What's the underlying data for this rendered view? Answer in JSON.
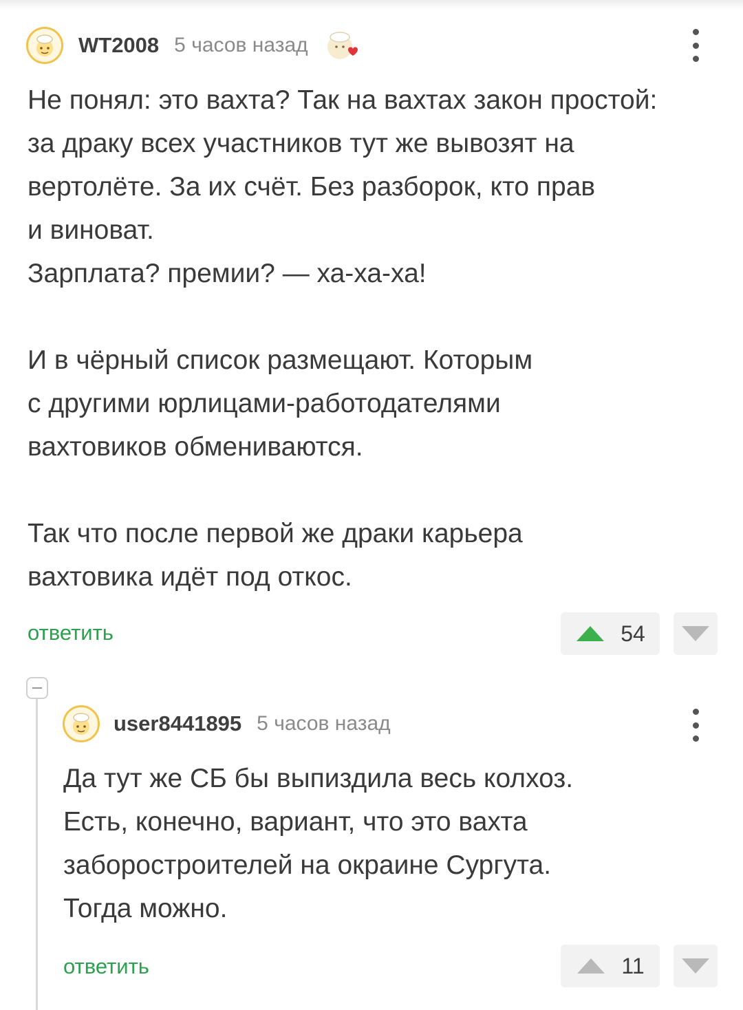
{
  "comments": [
    {
      "username": "WT2008",
      "time": "5 часов назад",
      "paragraphs": [
        [
          "Не понял: это вахта? Так на вахтах закон простой:",
          "за драку всех участников тут же вывозят на",
          "вертолёте. За их счёт. Без разборок, кто прав",
          "и виноват.",
          "Зарплата? премии? — ха-ха-ха!"
        ],
        [
          "И в чёрный список размещают. Которым",
          "с другими юрлицами-работодателями",
          "вахтовиков обмениваются."
        ],
        [
          "Так что после первой же драки карьера",
          "вахтовика идёт под откос."
        ]
      ],
      "reply_label": "ответить",
      "rating": "54",
      "upvoted": true
    },
    {
      "username": "user8441895",
      "time": "5 часов назад",
      "paragraphs": [
        [
          "Да тут же СБ бы выпиздила весь колхоз.",
          "Есть, конечно, вариант, что это вахта",
          "забороcтроителей на окраине Сургута.",
          "Тогда можно."
        ]
      ],
      "reply_label": "ответить",
      "rating": "11",
      "upvoted": false
    }
  ],
  "colors": {
    "accent_green": "#2ca04d",
    "upvote_active": "#3cb04c",
    "vote_inactive": "#b9b9b9",
    "avatar_ring": "#f2c34c"
  },
  "icons": [
    "avatar-icon",
    "heart-badge-icon",
    "more-dots-icon",
    "arrow-up-icon",
    "arrow-down-icon",
    "collapse-icon"
  ]
}
